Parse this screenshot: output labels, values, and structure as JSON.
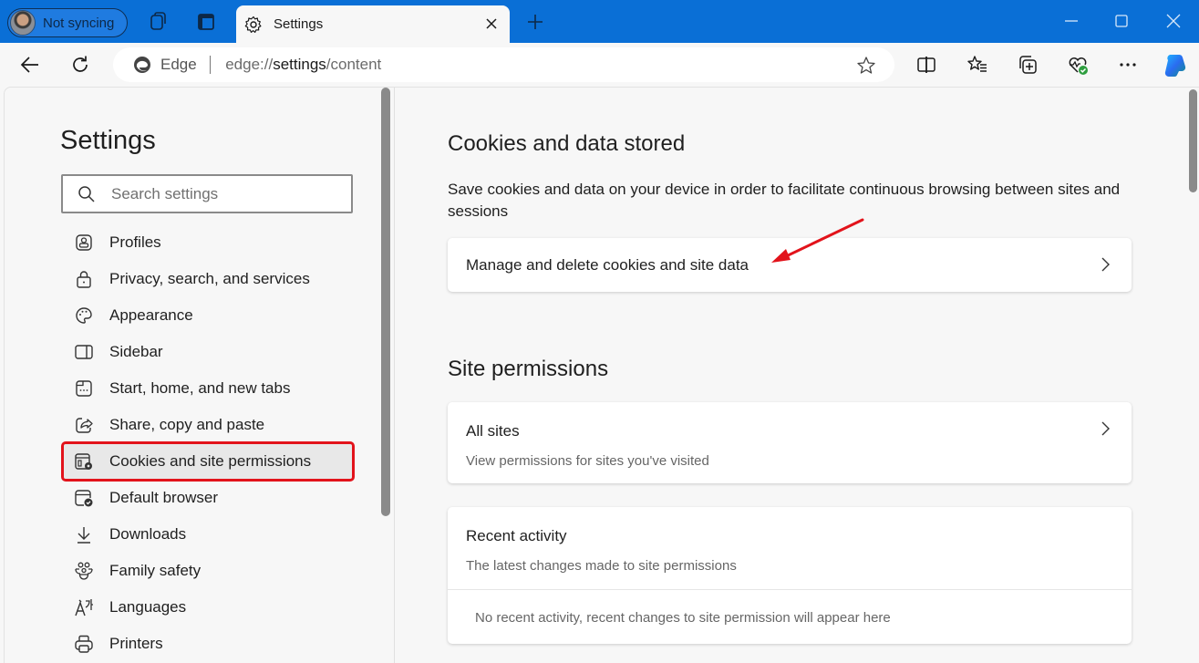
{
  "browser": {
    "profile_label": "Not syncing",
    "tab_title": "Settings",
    "address_brand": "Edge",
    "address_url_prefix": "edge://",
    "address_url_host": "settings",
    "address_url_path": "/content",
    "icons": {
      "workspaces": "workspaces-icon",
      "tab_actions": "tab-actions-icon",
      "tab": "gear-icon",
      "new_tab": "plus-icon",
      "back": "back-arrow-icon",
      "refresh": "refresh-icon",
      "favorite": "star-icon",
      "split_screen": "split-screen-icon",
      "favorites": "favorites-icon",
      "collections": "collections-icon",
      "browser_essentials": "heart-check-icon",
      "more": "more-icon",
      "copilot": "copilot-icon"
    }
  },
  "sidebar": {
    "title": "Settings",
    "search_placeholder": "Search settings",
    "search_value": "",
    "items": [
      {
        "label": "Profiles",
        "icon": "profile-icon",
        "active": false
      },
      {
        "label": "Privacy, search, and services",
        "icon": "lock-icon",
        "active": false
      },
      {
        "label": "Appearance",
        "icon": "palette-icon",
        "active": false
      },
      {
        "label": "Sidebar",
        "icon": "sidebar-icon",
        "active": false
      },
      {
        "label": "Start, home, and new tabs",
        "icon": "home-tabs-icon",
        "active": false
      },
      {
        "label": "Share, copy and paste",
        "icon": "share-icon",
        "active": false
      },
      {
        "label": "Cookies and site permissions",
        "icon": "cookies-settings-icon",
        "active": true
      },
      {
        "label": "Default browser",
        "icon": "default-browser-icon",
        "active": false
      },
      {
        "label": "Downloads",
        "icon": "download-icon",
        "active": false
      },
      {
        "label": "Family safety",
        "icon": "family-icon",
        "active": false
      },
      {
        "label": "Languages",
        "icon": "languages-icon",
        "active": false
      },
      {
        "label": "Printers",
        "icon": "printer-icon",
        "active": false
      }
    ]
  },
  "content": {
    "cookies_section": {
      "heading": "Cookies and data stored",
      "description": "Save cookies and data on your device in order to facilitate continuous browsing between sites and sessions",
      "manage_label": "Manage and delete cookies and site data"
    },
    "permissions_section": {
      "heading": "Site permissions",
      "all_sites_title": "All sites",
      "all_sites_subtitle": "View permissions for sites you've visited",
      "recent_title": "Recent activity",
      "recent_subtitle": "The latest changes made to site permissions",
      "recent_empty": "No recent activity, recent changes to site permission will appear here"
    }
  },
  "colors": {
    "titlebar": "#0a6fd6",
    "highlight_annotation": "#e2131b"
  }
}
